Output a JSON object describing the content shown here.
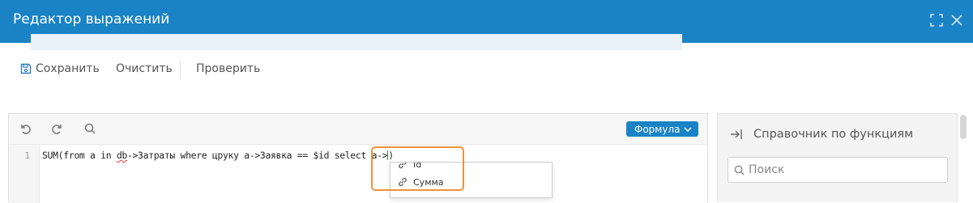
{
  "window": {
    "title": "Редактор выражений",
    "maximize_icon": "maximize-icon",
    "close_icon": "close-icon",
    "accent": "#1a83c6"
  },
  "toolbar": {
    "save_label": "Сохранить",
    "clear_label": "Очистить",
    "check_label": "Проверить"
  },
  "editor": {
    "mode_label": "Формула",
    "line_number": "1",
    "code": {
      "part1": "SUM(from a in ",
      "err": "db",
      "part2": "->Затраты where црукy a->Заявка == $id select a->",
      "part3": ")"
    },
    "autocomplete": [
      {
        "label": "Id",
        "icon": "link-icon"
      },
      {
        "label": "Сумма",
        "icon": "link-icon"
      }
    ]
  },
  "sidebar": {
    "title": "Справочник по функциям",
    "search_placeholder": "Поиск"
  }
}
